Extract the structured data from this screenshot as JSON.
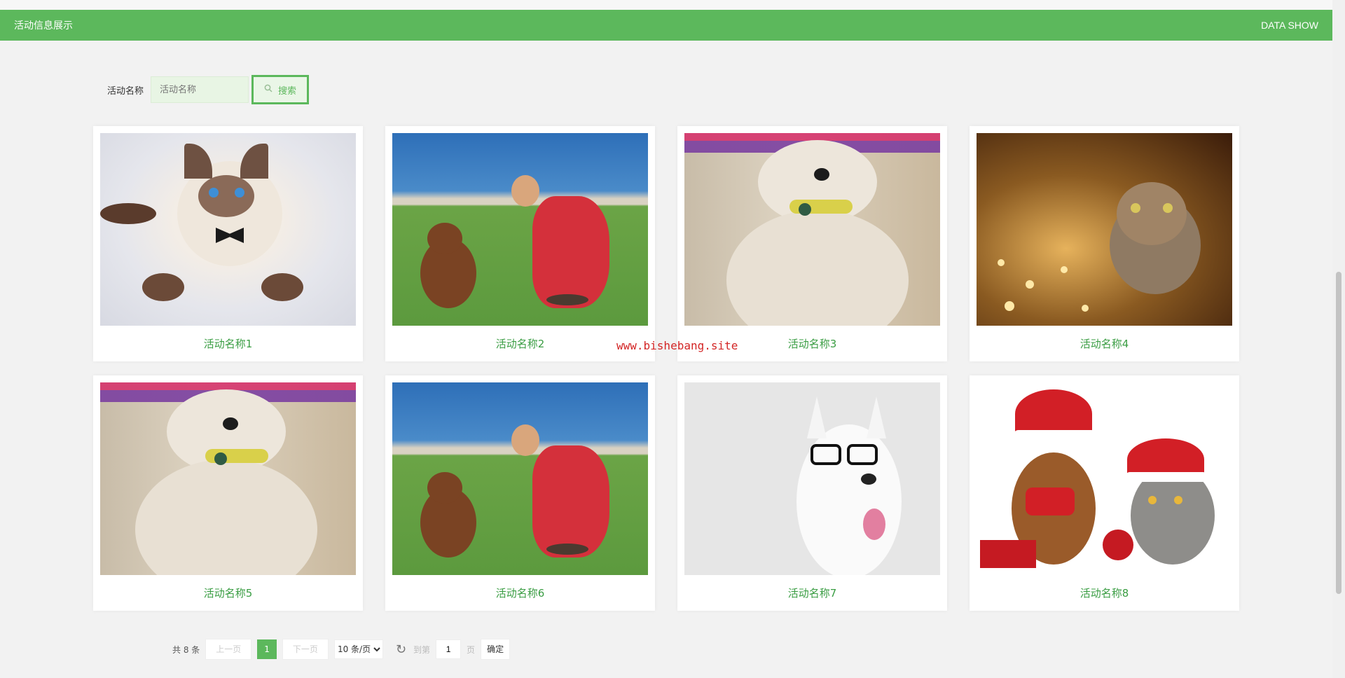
{
  "header": {
    "title": "活动信息展示",
    "right": "DATA SHOW"
  },
  "search": {
    "label": "活动名称",
    "placeholder": "活动名称",
    "button": "搜索"
  },
  "cards": [
    {
      "name": "活动名称1"
    },
    {
      "name": "活动名称2"
    },
    {
      "name": "活动名称3"
    },
    {
      "name": "活动名称4"
    },
    {
      "name": "活动名称5"
    },
    {
      "name": "活动名称6"
    },
    {
      "name": "活动名称7"
    },
    {
      "name": "活动名称8"
    }
  ],
  "watermark": "www.bishebang.site",
  "pagination": {
    "total": "共 8 条",
    "prev": "上一页",
    "current": "1",
    "next": "下一页",
    "page_size": "10 条/页",
    "goto_label": "到第",
    "goto_value": "1",
    "page_suffix": "页",
    "confirm": "确定"
  },
  "colors": {
    "accent": "#5cb85c",
    "card_title": "#3a9d43"
  }
}
